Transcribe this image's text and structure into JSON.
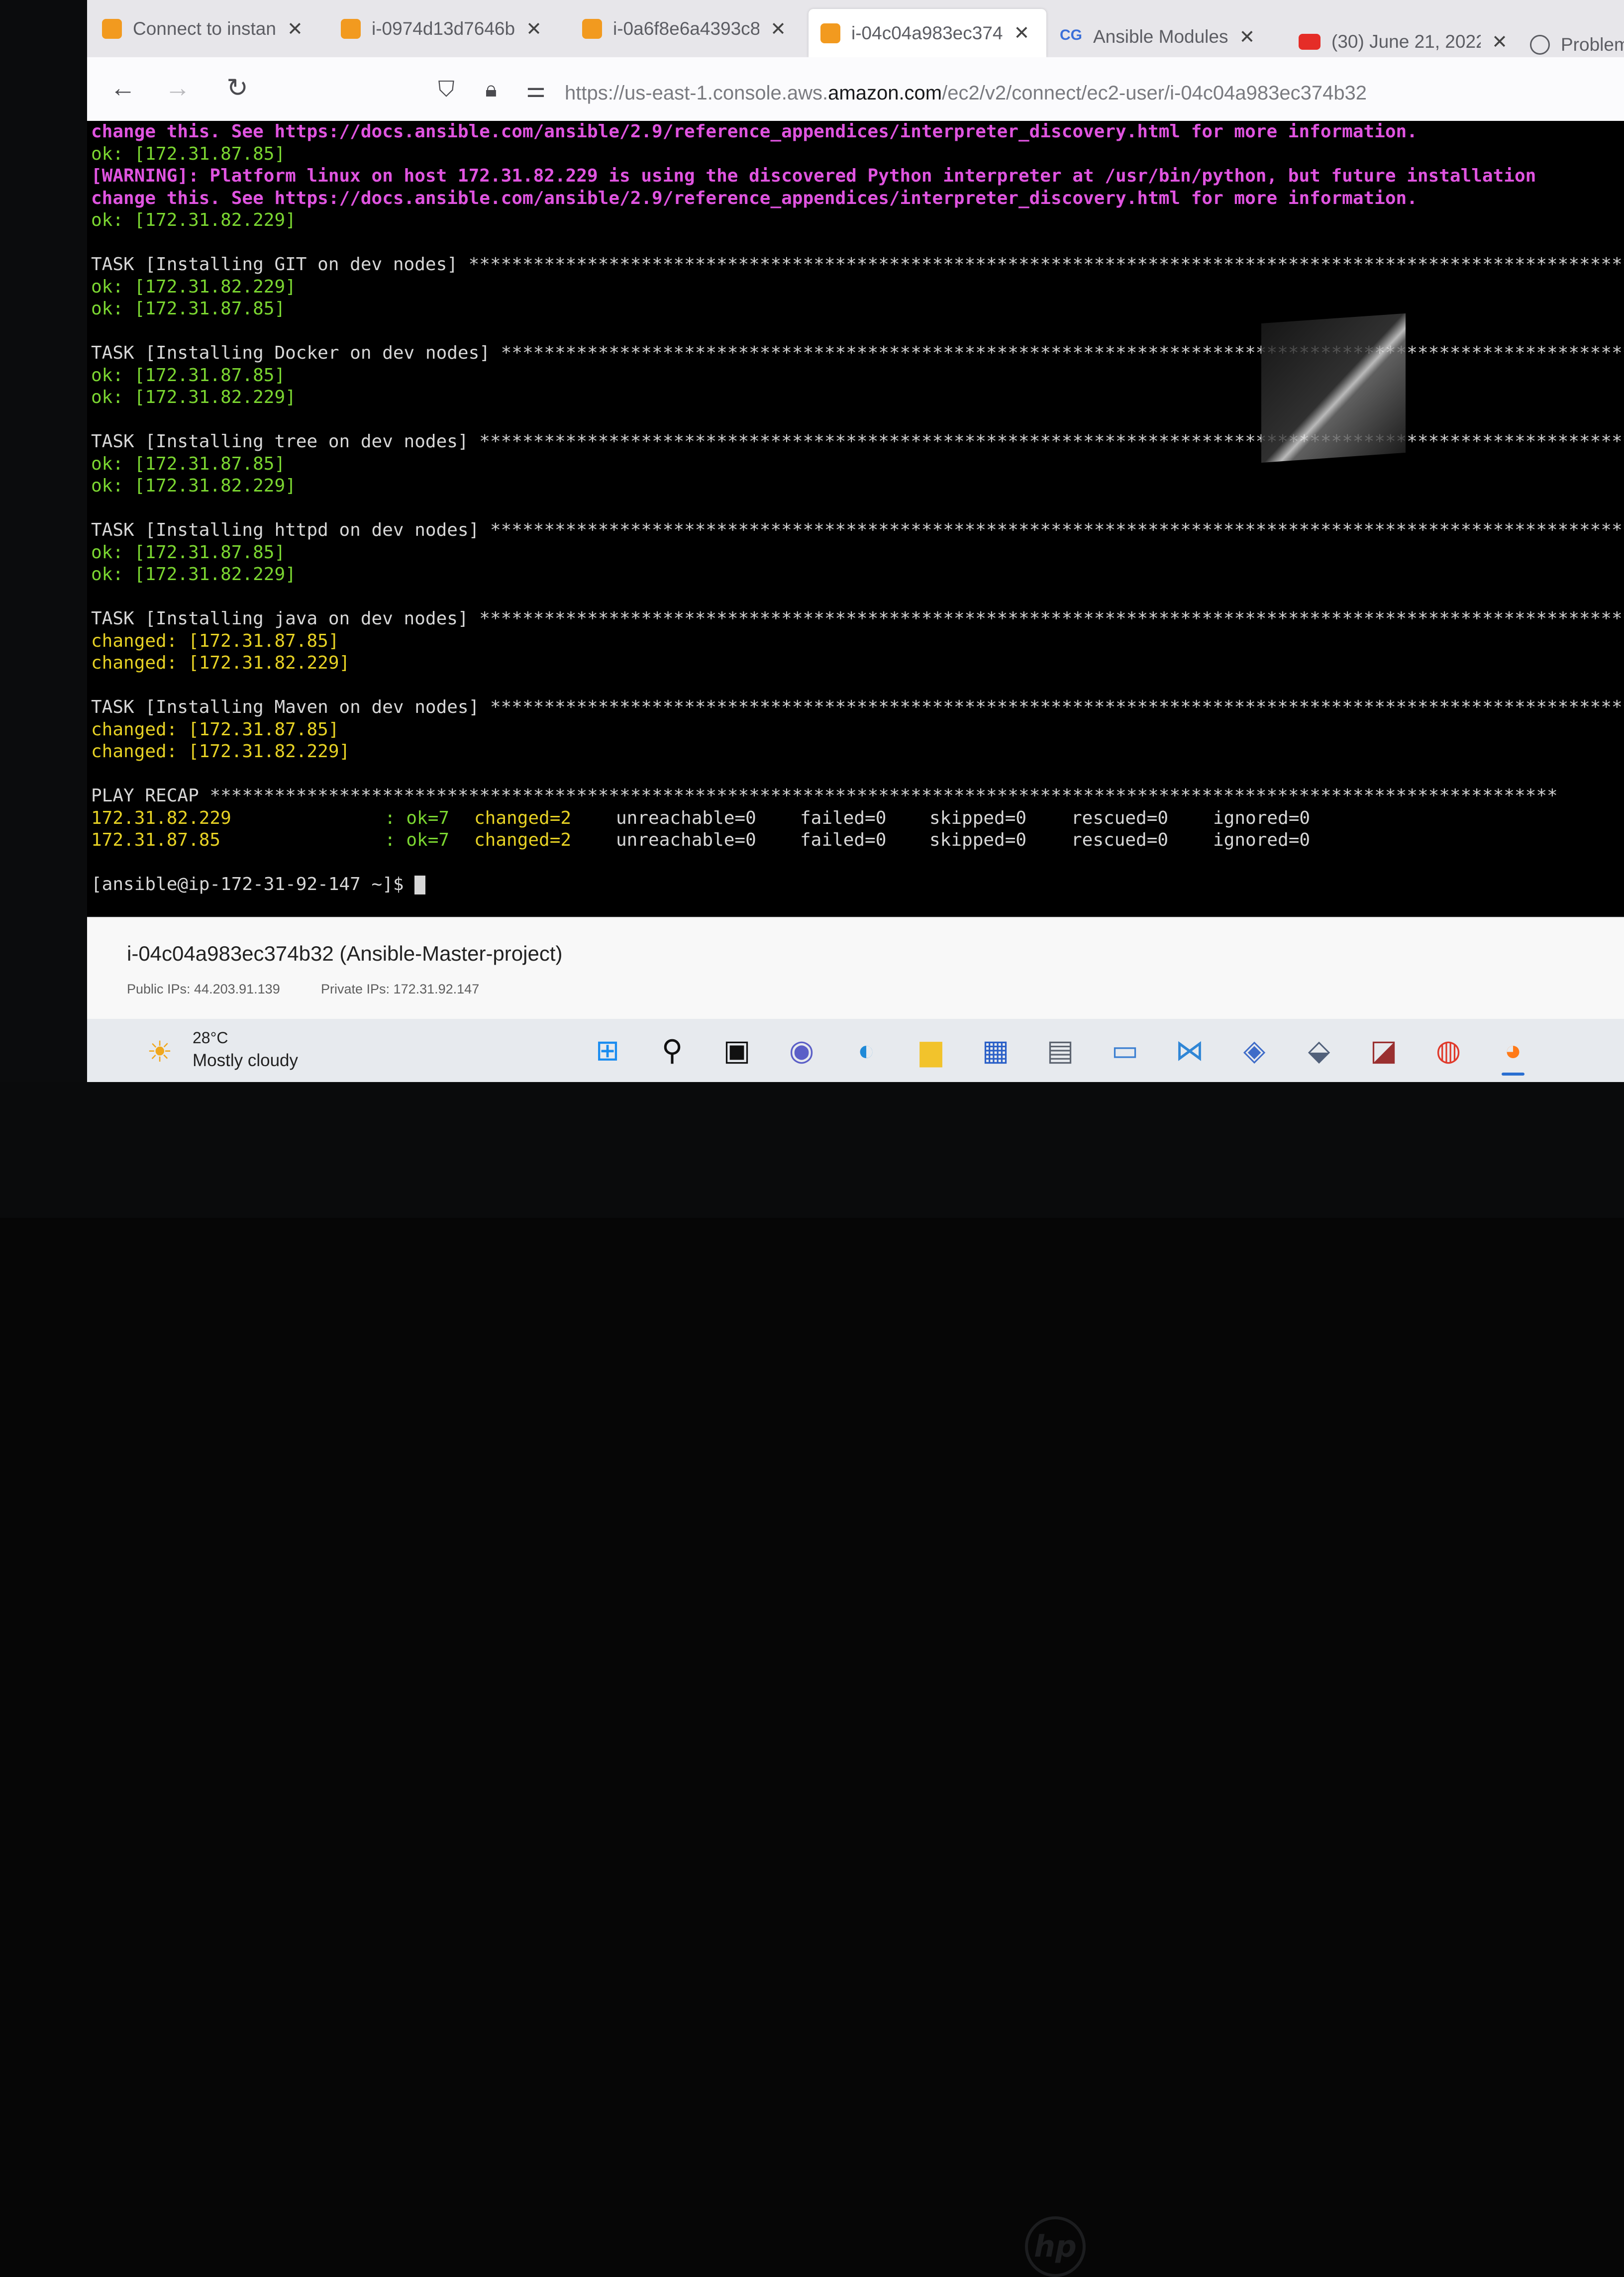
{
  "browser": {
    "tabs": [
      {
        "icon": "aws-icon",
        "label": "Connect to instan",
        "active": false
      },
      {
        "icon": "aws-icon",
        "label": "i-0974d13d7646b",
        "active": false
      },
      {
        "icon": "aws-icon",
        "label": "i-0a6f8e6a4393c8",
        "active": false
      },
      {
        "icon": "aws-icon",
        "label": "i-04c04a983ec374",
        "active": true
      },
      {
        "icon": "cg-icon",
        "label": "Ansible Modules",
        "active": false
      },
      {
        "icon": "youtube-icon",
        "label": "(30) June 21, 2022",
        "active": false
      },
      {
        "icon": "info-icon",
        "label": "Problem",
        "active": false
      }
    ],
    "close_glyph": "✕",
    "url_prefix": "https://us-east-1.console.aws.",
    "url_host": "amazon.com",
    "url_path": "/ec2/v2/connect/ec2-user/i-04c04a983ec374b32"
  },
  "terminal": {
    "l01": "change this. See https://docs.ansible.com/ansible/2.9/reference_appendices/interpreter_discovery.html for more information.",
    "l02": "ok: [172.31.87.85]",
    "l03": "[WARNING]: Platform linux on host 172.31.82.229 is using the discovered Python interpreter at /usr/bin/python, but future installation",
    "l04": "change this. See https://docs.ansible.com/ansible/2.9/reference_appendices/interpreter_discovery.html for more information.",
    "l05": "ok: [172.31.82.229]",
    "t1": "TASK [Installing GIT on dev nodes]",
    "t1a": "ok: [172.31.82.229]",
    "t1b": "ok: [172.31.87.85]",
    "t2": "TASK [Installing Docker on dev nodes]",
    "t2a": "ok: [172.31.87.85]",
    "t2b": "ok: [172.31.82.229]",
    "t3": "TASK [Installing tree on dev nodes]",
    "t3a": "ok: [172.31.87.85]",
    "t3b": "ok: [172.31.82.229]",
    "t4": "TASK [Installing httpd on dev nodes]",
    "t4a": "ok: [172.31.87.85]",
    "t4b": "ok: [172.31.82.229]",
    "t5": "TASK [Installing java on dev nodes]",
    "t5a": "changed: [172.31.87.85]",
    "t5b": "changed: [172.31.82.229]",
    "t6": "TASK [Installing Maven on dev nodes]",
    "t6a": "changed: [172.31.87.85]",
    "t6b": "changed: [172.31.82.229]",
    "recap": "PLAY RECAP",
    "stars": "*****************************************************************************************************************************",
    "recap_rows": [
      {
        "host": "172.31.82.229",
        "ok": ": ok=7",
        "changed": "changed=2",
        "unreachable": "unreachable=0",
        "failed": "failed=0",
        "skipped": "skipped=0",
        "rescued": "rescued=0",
        "ignored": "ignored=0"
      },
      {
        "host": "172.31.87.85",
        "ok": ": ok=7",
        "changed": "changed=2",
        "unreachable": "unreachable=0",
        "failed": "failed=0",
        "skipped": "skipped=0",
        "rescued": "rescued=0",
        "ignored": "ignored=0"
      }
    ],
    "prompt": "[ansible@ip-172-31-92-147 ~]$ "
  },
  "instance": {
    "title": "i-04c04a983ec374b32 (Ansible-Master-project)",
    "public_ips": "Public IPs: 44.203.91.139",
    "private_ips": "Private IPs: 172.31.92.147"
  },
  "taskbar": {
    "temperature": "28°C",
    "condition": "Mostly cloudy"
  },
  "colors": {
    "warning": "#e054e0",
    "ok": "#7bd631",
    "changed": "#e6d124"
  }
}
